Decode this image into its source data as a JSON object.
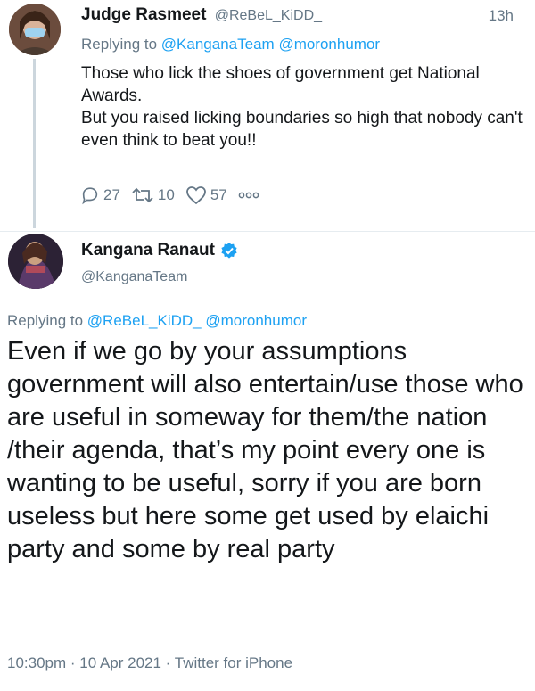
{
  "reply_tweet": {
    "name": "Judge Rasmeet",
    "handle": "@ReBeL_KiDD_",
    "time": "13h",
    "replying_prefix": "Replying to",
    "mentions": [
      "@KanganaTeam",
      "@moronhumor"
    ],
    "text_lines": [
      "Those who lick the shoes of government get National Awards.",
      "But you raised licking boundaries so high that nobody can't even think to beat you!!"
    ],
    "actions": {
      "replies": "27",
      "retweets": "10",
      "likes": "57"
    }
  },
  "main_tweet": {
    "name": "Kangana Ranaut",
    "handle": "@KanganaTeam",
    "replying_prefix": "Replying to",
    "mentions": [
      "@ReBeL_KiDD_",
      "@moronhumor"
    ],
    "text": "Even if we go by your assumptions government will also entertain/use those who are useful in someway for them/the nation /their agenda, that’s my point every one is wanting to be useful, sorry if you are born useless but here some get used by elaichi party and some by real party",
    "meta": "10:30pm · 10 Apr 2021 · Twitter for iPhone"
  },
  "colors": {
    "accent": "#1da1f2",
    "muted": "#657786",
    "text": "#14171a"
  }
}
